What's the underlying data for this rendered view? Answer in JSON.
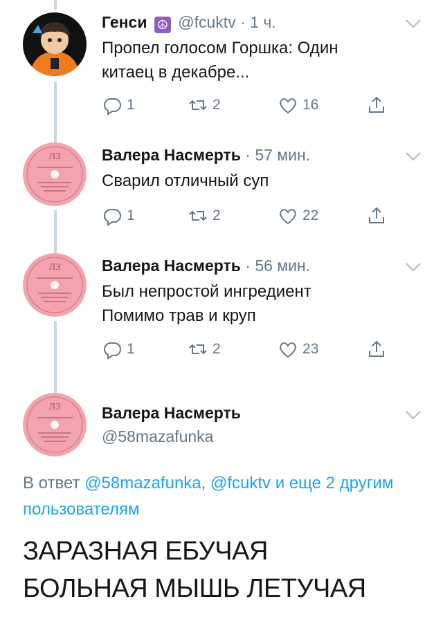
{
  "tweets": [
    {
      "name": "Генси",
      "emoji": "☮",
      "handle": "@fcuktv",
      "time": "· 1 ч.",
      "lines": [
        "Пропел голосом Горшка: Один",
        "китаец в декабре..."
      ],
      "replies": "1",
      "retweets": "2",
      "likes": "16"
    },
    {
      "name": "Валера Насмерть",
      "time": "· 57 мин.",
      "lines": [
        "Сварил отличный суп"
      ],
      "replies": "1",
      "retweets": "2",
      "likes": "22"
    },
    {
      "name": "Валера Насмерть",
      "time": "· 56 мин.",
      "lines": [
        "Был непростой ингредиент",
        "Помимо трав и круп"
      ],
      "replies": "1",
      "retweets": "2",
      "likes": "23"
    }
  ],
  "focused": {
    "name": "Валера Насмерть",
    "handle": "@58mazafunka",
    "reply_prefix": "В ответ",
    "reply_mentions": "@58mazafunka, @fcuktv",
    "reply_suffix": "и еще 2 другим пользователям",
    "lines": [
      "ЗАРАЗНАЯ ЕБУЧАЯ",
      "БОЛЬНАЯ МЫШЬ ЛЕТУЧАЯ"
    ]
  },
  "colors": {
    "link": "#1da1f2",
    "muted": "#657786",
    "record": "#f3a3ad"
  },
  "icons": [
    "reply-icon",
    "retweet-icon",
    "like-icon",
    "share-icon",
    "chevron-down-icon",
    "peace-icon"
  ]
}
